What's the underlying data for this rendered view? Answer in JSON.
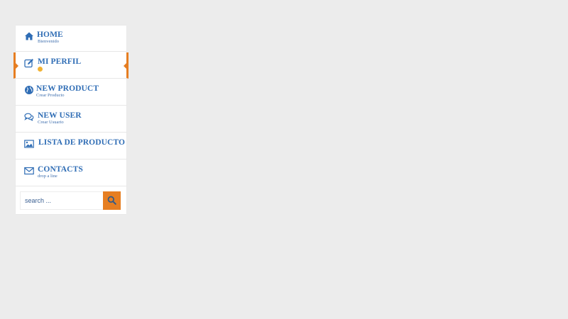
{
  "menu": {
    "items": [
      {
        "label": "HOME",
        "sub": "Bienvenido",
        "icon": "home-icon"
      },
      {
        "label": "MI PERFIL",
        "sub": "",
        "icon": "edit-icon",
        "active": true,
        "sub_icon": "smiley-emoji-icon"
      },
      {
        "label": "NEW PRODUCT",
        "sub": "Crear Producto",
        "icon": "globe-icon"
      },
      {
        "label": "NEW USER",
        "sub": "Crear Usuario",
        "icon": "chat-icon"
      },
      {
        "label": "LISTA DE PRODUCTO",
        "sub": "",
        "icon": "image-icon"
      },
      {
        "label": "CONTACTS",
        "sub": "drop a line",
        "icon": "envelope-icon"
      }
    ]
  },
  "search": {
    "placeholder": "search ...",
    "value": "",
    "button_icon": "search-icon"
  },
  "colors": {
    "accent": "#e67e22",
    "link": "#2f6db5",
    "background": "#ececec",
    "panel": "#ffffff"
  }
}
